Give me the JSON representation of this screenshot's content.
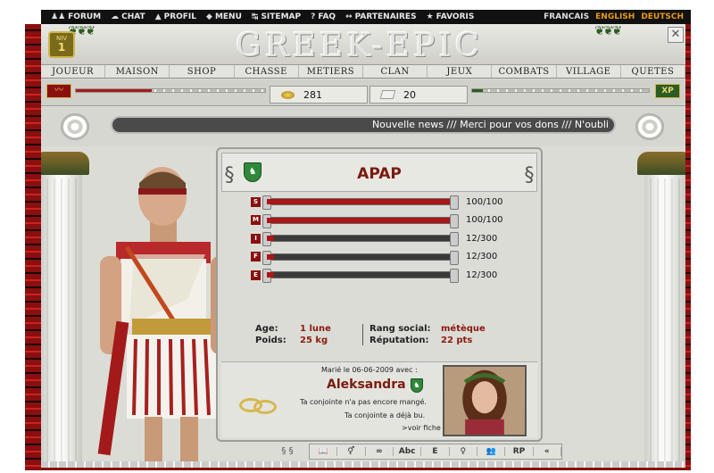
{
  "topnav": [
    {
      "icon": "forum-icon",
      "glyph": "♟♟",
      "label": "FORUM"
    },
    {
      "icon": "chat-icon",
      "glyph": "☁",
      "label": "CHAT"
    },
    {
      "icon": "profile-icon",
      "glyph": "▲",
      "label": "PROFIL"
    },
    {
      "icon": "menu-icon",
      "glyph": "◆",
      "label": "MENU"
    },
    {
      "icon": "sitemap-icon",
      "glyph": "↹",
      "label": "SITEMAP"
    },
    {
      "icon": "faq-icon",
      "glyph": "?",
      "label": "FAQ"
    },
    {
      "icon": "partners-icon",
      "glyph": "↔",
      "label": "PARTENAIRES"
    },
    {
      "icon": "star-icon",
      "glyph": "★",
      "label": "FAVORIS"
    }
  ],
  "languages": [
    "FRANCAIS",
    "ENGLISH",
    "DEUTSCH"
  ],
  "logo": "GREEK-EPIC",
  "level": {
    "label": "NIV",
    "value": "1"
  },
  "nav": [
    "JOUEUR",
    "MAISON",
    "SHOP",
    "CHASSE",
    "METIERS",
    "CLAN",
    "JEUX",
    "COMBATS",
    "VILLAGE",
    "QUETES"
  ],
  "resources": {
    "gold": "281",
    "stone": "20",
    "xp_label": "XP"
  },
  "news": "Nouvelle news /// Merci pour vos dons /// N'oubli",
  "character": {
    "name": "APAP"
  },
  "stats": [
    {
      "key": "S",
      "value": "100/100",
      "fill": 1.0
    },
    {
      "key": "M",
      "value": "100/100",
      "fill": 1.0
    },
    {
      "key": "I",
      "value": "12/300",
      "fill": 0.04
    },
    {
      "key": "F",
      "value": "12/300",
      "fill": 0.04
    },
    {
      "key": "E",
      "value": "12/300",
      "fill": 0.04
    }
  ],
  "info": {
    "age_label": "Age:",
    "age_value": "1 lune",
    "weight_label": "Poids:",
    "weight_value": "25 kg",
    "rank_label": "Rang social:",
    "rank_value": "métèque",
    "rep_label": "Réputation:",
    "rep_value": "22 pts"
  },
  "marriage": {
    "married_label": "Marié le 06-06-2009 avec :",
    "spouse": "Aleksandra",
    "note1": "Ta conjointe n'a pas encore mangé.",
    "note2": "Ta conjointe a déjà bu.",
    "link": ">voir fiche"
  },
  "toolbar": [
    "📖",
    "⚥",
    "∞",
    "Abc",
    "E",
    "♀",
    "👥",
    "RP",
    "«"
  ],
  "colors": {
    "accent": "#8a0f0f",
    "gold": "#d4b24c",
    "nav_text": "#222222"
  }
}
